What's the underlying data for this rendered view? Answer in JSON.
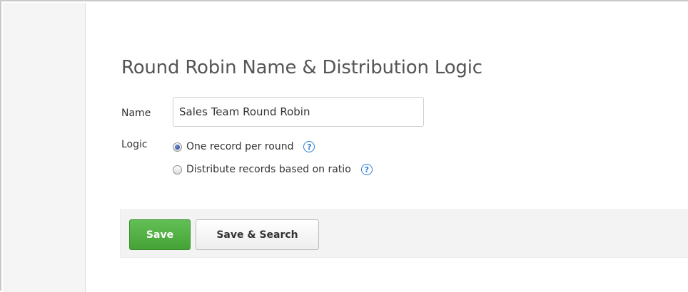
{
  "form": {
    "title": "Round Robin Name & Distribution Logic",
    "name_label": "Name",
    "name_value": "Sales Team Round Robin",
    "logic_label": "Logic",
    "logic_options": [
      {
        "label": "One record per round",
        "selected": true,
        "help_icon": "question-circle-icon"
      },
      {
        "label": "Distribute records based on ratio",
        "selected": false,
        "help_icon": "question-circle-icon"
      }
    ],
    "help_glyph": "?"
  },
  "actions": {
    "save_label": "Save",
    "save_search_label": "Save & Search"
  },
  "colors": {
    "save_button": "#4cae3f",
    "help_icon": "#2a7fd4",
    "button_bar_bg": "#f3f3f3",
    "sidebar_bg": "#f5f5f5"
  }
}
